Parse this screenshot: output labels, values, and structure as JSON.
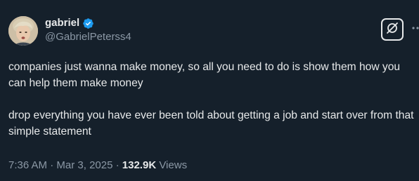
{
  "author": {
    "display_name": "gabriel",
    "handle": "@GabrielPeterss4",
    "verified": true
  },
  "tweet": {
    "paragraphs": [
      "companies just wanna make money, so all you need to do is show them how you can help them make money",
      "drop everything you have ever been told about getting a job and start over from that simple statement"
    ]
  },
  "meta": {
    "time": "7:36 AM",
    "separator1": "·",
    "date": "Mar 3, 2025",
    "separator2": "·",
    "views_count": "132.9K",
    "views_label": "Views"
  },
  "icons": {
    "verified": "verified-badge-icon",
    "grok": "grok-icon",
    "more": "more-options-icon"
  },
  "colors": {
    "background": "#15202b",
    "text": "#e7e9ea",
    "secondary": "#8b98a5",
    "verified": "#1d9bf0"
  }
}
